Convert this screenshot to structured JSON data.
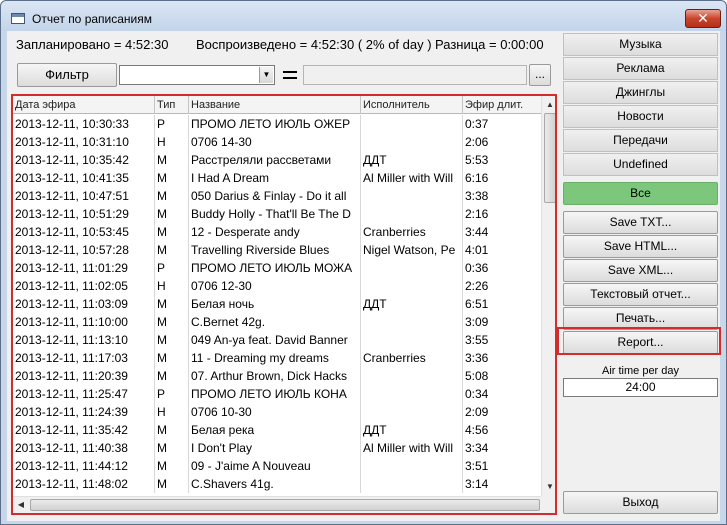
{
  "window": {
    "title": "Отчет по рaписаниям",
    "close_icon": "close-icon"
  },
  "stats": {
    "planned": "Запланировано = 4:52:30",
    "played": "Воспроизведено = 4:52:30 ( 2% of day )",
    "diff": "Разница = 0:00:00"
  },
  "filter": {
    "button_label": "Фильтр",
    "combo_value": "",
    "value": "",
    "browse_label": "..."
  },
  "table": {
    "columns": [
      "Дата эфира",
      "Тип",
      "Название",
      "Исполнитель",
      "Эфир длит."
    ],
    "rows": [
      [
        "2013-12-11, 10:30:33",
        "P",
        "ПРОМО ЛЕТО ИЮЛЬ ОЖЕР",
        "",
        "0:37"
      ],
      [
        "2013-12-11, 10:31:10",
        "H",
        "0706 14-30",
        "",
        "2:06"
      ],
      [
        "2013-12-11, 10:35:42",
        "M",
        "Расстреляли рассветами",
        "ДДТ",
        "5:53"
      ],
      [
        "2013-12-11, 10:41:35",
        "M",
        "I Had A Dream",
        "Al Miller with Will",
        "6:16"
      ],
      [
        "2013-12-11, 10:47:51",
        "M",
        "050 Darius & Finlay - Do it all",
        "",
        "3:38"
      ],
      [
        "2013-12-11, 10:51:29",
        "M",
        "Buddy Holly - That'll Be The D",
        "",
        "2:16"
      ],
      [
        "2013-12-11, 10:53:45",
        "M",
        "12 - Desperate andy",
        "Cranberries",
        "3:44"
      ],
      [
        "2013-12-11, 10:57:28",
        "M",
        "Travelling Riverside Blues",
        "Nigel Watson, Pe",
        "4:01"
      ],
      [
        "2013-12-11, 11:01:29",
        "P",
        "ПРОМО ЛЕТО ИЮЛЬ МОЖА",
        "",
        "0:36"
      ],
      [
        "2013-12-11, 11:02:05",
        "H",
        "0706 12-30",
        "",
        "2:26"
      ],
      [
        "2013-12-11, 11:03:09",
        "M",
        "Белая ночь",
        "ДДТ",
        "6:51"
      ],
      [
        "2013-12-11, 11:10:00",
        "M",
        "C.Bernet 42g.",
        "",
        "3:09"
      ],
      [
        "2013-12-11, 11:13:10",
        "M",
        "049 An-ya feat. David Banner",
        "",
        "3:55"
      ],
      [
        "2013-12-11, 11:17:03",
        "M",
        "11 - Dreaming my dreams",
        "Cranberries",
        "3:36"
      ],
      [
        "2013-12-11, 11:20:39",
        "M",
        "07. Arthur Brown, Dick Hacks",
        "",
        "5:08"
      ],
      [
        "2013-12-11, 11:25:47",
        "P",
        "ПРОМО ЛЕТО ИЮЛЬ КОНА",
        "",
        "0:34"
      ],
      [
        "2013-12-11, 11:24:39",
        "H",
        "0706 10-30",
        "",
        "2:09"
      ],
      [
        "2013-12-11, 11:35:42",
        "M",
        "Белая река",
        "ДДТ",
        "4:56"
      ],
      [
        "2013-12-11, 11:40:38",
        "M",
        "I Don't Play",
        "Al Miller with Will",
        "3:34"
      ],
      [
        "2013-12-11, 11:44:12",
        "M",
        "09 - J'aime A Nouveau",
        "",
        "3:51"
      ],
      [
        "2013-12-11, 11:48:02",
        "M",
        "C.Shavers 41g.",
        "",
        "3:14"
      ]
    ]
  },
  "sidebar": {
    "categories": [
      "Музыка",
      "Реклама",
      "Джинглы",
      "Новости",
      "Передачи",
      "Undefined"
    ],
    "all_label": "Все",
    "actions": [
      "Save TXT...",
      "Save HTML...",
      "Save XML...",
      "Текстовый отчет...",
      "Печать...",
      "Report..."
    ],
    "airtime_label": "Air time per day",
    "airtime_value": "24:00",
    "exit_label": "Выход"
  },
  "colors": {
    "accent_green": "#7dc77d",
    "highlight_red": "#d22c2c"
  }
}
